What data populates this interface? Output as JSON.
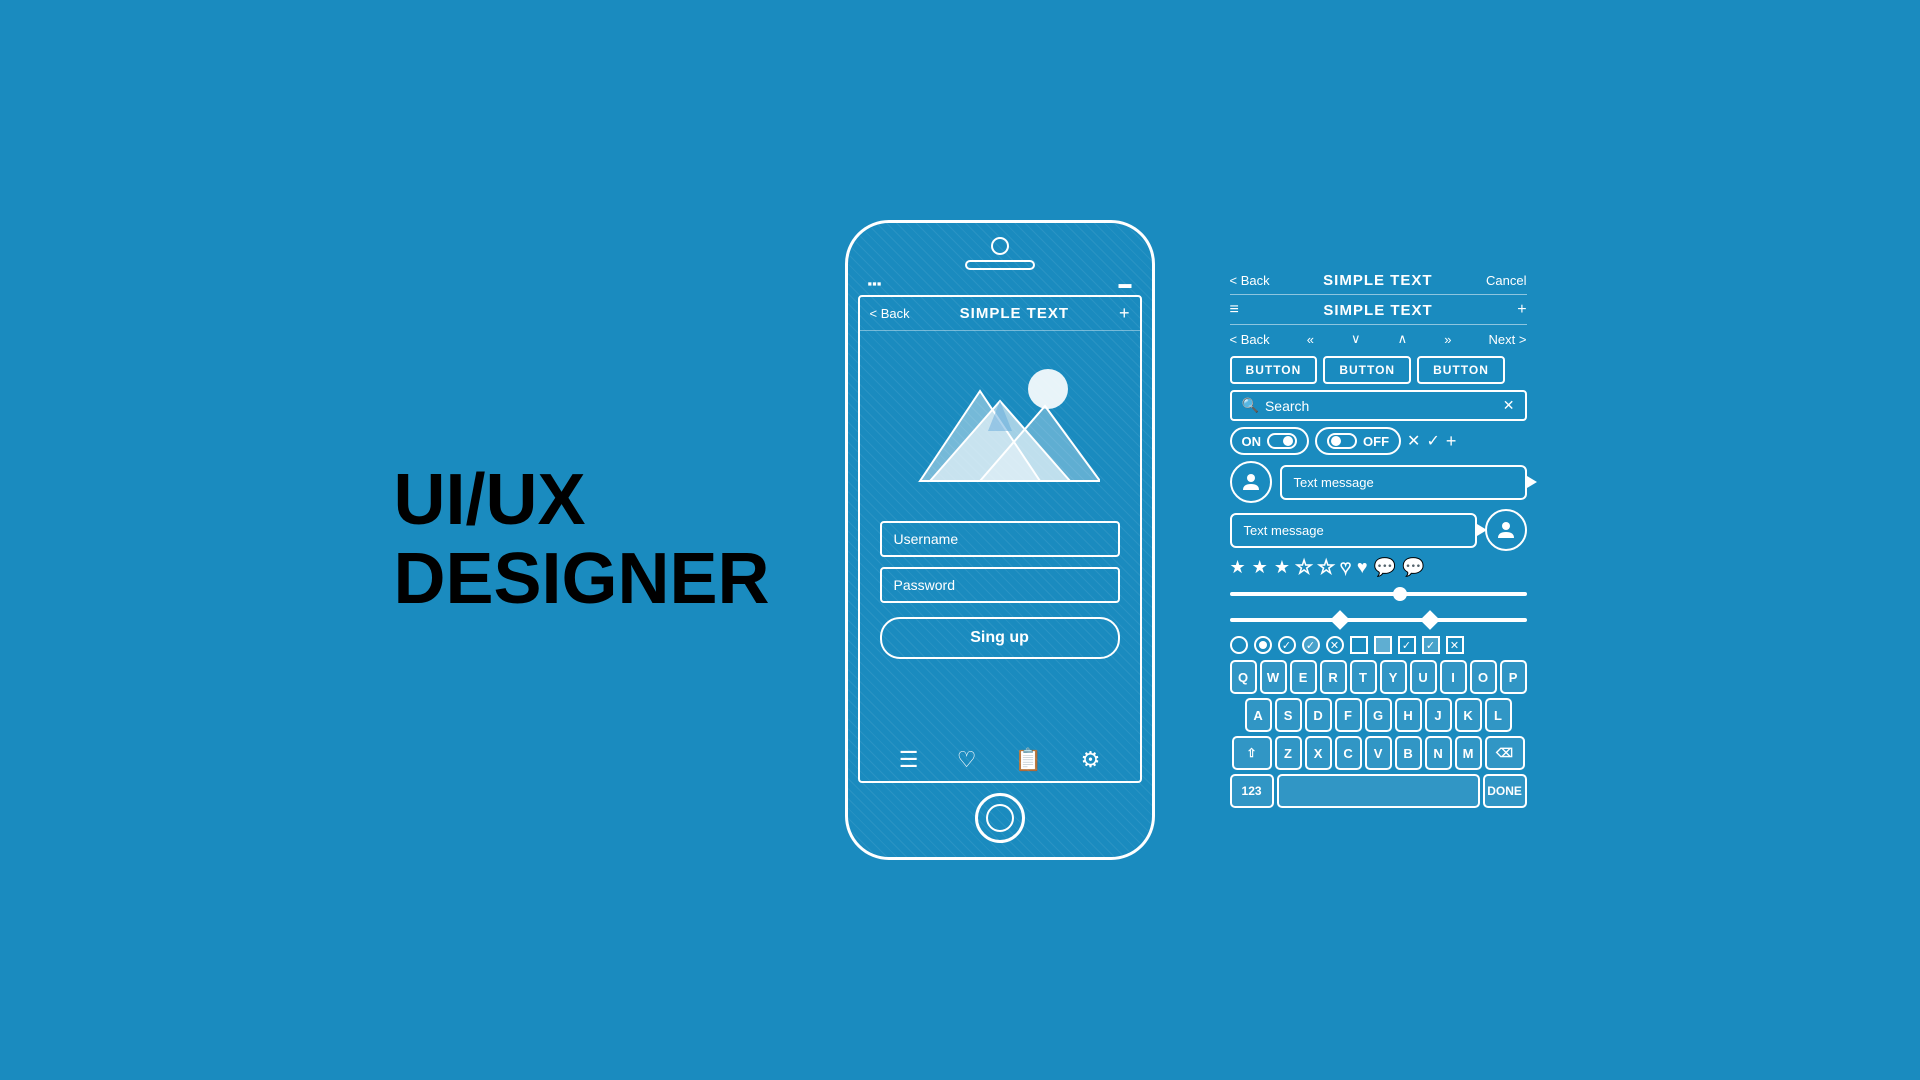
{
  "title": {
    "line1": "UI/UX",
    "line2": "DESIGNER"
  },
  "phone": {
    "nav": {
      "back": "< Back",
      "title": "SIMPLE TEXT",
      "plus": "+"
    },
    "username_placeholder": "Username",
    "password_placeholder": "Password",
    "signup_label": "Sing up",
    "bottom_icons": [
      "☰",
      "♡",
      "📋",
      "⚙"
    ]
  },
  "ui_kit": {
    "nav1_back": "< Back",
    "nav1_title": "SIMPLE TEXT",
    "nav1_cancel": "Cancel",
    "nav2_menu": "≡",
    "nav2_title": "SIMPLE TEXT",
    "nav2_plus": "+",
    "nav3_back": "< Back",
    "nav3_prev_prev": "«",
    "nav3_down": "∨",
    "nav3_up": "∧",
    "nav3_next_next": "»",
    "nav3_next": "Next >",
    "buttons": [
      "BUTTON",
      "BUTTON",
      "BUTTON"
    ],
    "search_placeholder": "Search",
    "toggle_on": "ON",
    "toggle_off": "OFF",
    "text_message_placeholder": "Text message",
    "text_message_placeholder2": "Text message",
    "keyboard": {
      "row1": [
        "Q",
        "W",
        "E",
        "R",
        "T",
        "Y",
        "U",
        "I",
        "O",
        "P"
      ],
      "row2": [
        "A",
        "S",
        "D",
        "F",
        "G",
        "H",
        "J",
        "K",
        "L"
      ],
      "row3_shift": "⇧",
      "row3": [
        "Z",
        "X",
        "C",
        "V",
        "B",
        "N",
        "M"
      ],
      "row3_del": "⌫",
      "row4_num": "123",
      "row4_done": "DONE"
    }
  }
}
